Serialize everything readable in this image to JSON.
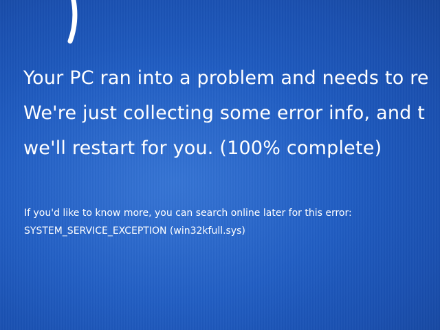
{
  "colors": {
    "background": "#1f5cc2",
    "text": "#ffffff"
  },
  "icons": {
    "sad_face": "sad-face-emoticon"
  },
  "message": {
    "line1": "Your PC ran into a problem and needs to re",
    "line2": "We're just collecting some error info, and t",
    "line3": "we'll restart for you. (100% complete)"
  },
  "progress_percent": 100,
  "details": {
    "help_text": "If you'd like to know more, you can search online later for this error:",
    "stop_code": "SYSTEM_SERVICE_EXCEPTION (win32kfull.sys)"
  }
}
